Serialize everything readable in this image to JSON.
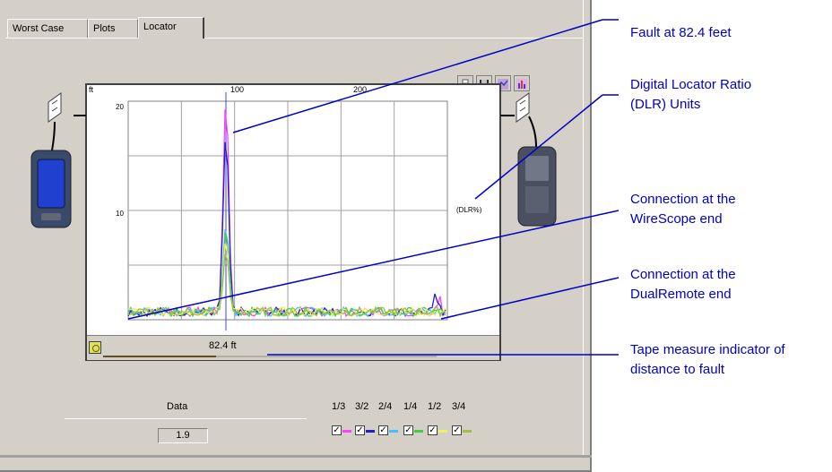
{
  "tabs": [
    {
      "label": "Worst Case",
      "active": false
    },
    {
      "label": "Plots",
      "active": false
    },
    {
      "label": "Locator",
      "active": true
    }
  ],
  "toolbar": {
    "icons": [
      "printer-icon",
      "save-icon",
      "zoom-icon",
      "chart-settings-icon"
    ]
  },
  "plot": {
    "top_axis_ticks": [
      "ft",
      "100",
      "200"
    ],
    "left_axis_ticks": [
      "20",
      "10"
    ],
    "unit_label": "(DLR%)",
    "tape_value": "82.4 ft",
    "tape_fraction": 0.34
  },
  "data_panel": {
    "label": "Data",
    "value": "1.9"
  },
  "pairs": [
    {
      "label": "1/3",
      "checked": true,
      "color": "#ff40ff"
    },
    {
      "label": "3/2",
      "checked": true,
      "color": "#2020c0"
    },
    {
      "label": "2/4",
      "checked": true,
      "color": "#40c0ff"
    },
    {
      "label": "1/4",
      "checked": true,
      "color": "#40d040"
    },
    {
      "label": "1/2",
      "checked": true,
      "color": "#f0f060"
    },
    {
      "label": "3/4",
      "checked": true,
      "color": "#a0c040"
    }
  ],
  "annotations": [
    {
      "lines": [
        "Fault at 82.4 feet"
      ]
    },
    {
      "lines": [
        "Digital Locator Ratio",
        "(DLR) Units"
      ]
    },
    {
      "lines": [
        "Connection at the",
        "WireScope end"
      ]
    },
    {
      "lines": [
        "Connection at the",
        "DualRemote end"
      ]
    },
    {
      "lines": [
        "Tape measure indicator of",
        "distance to fault"
      ]
    }
  ],
  "colors": {
    "annotation": "#0000c8",
    "window": "#d4d0c8",
    "device_body": "#3a4a6a",
    "device_screen": "#2040d0"
  }
}
